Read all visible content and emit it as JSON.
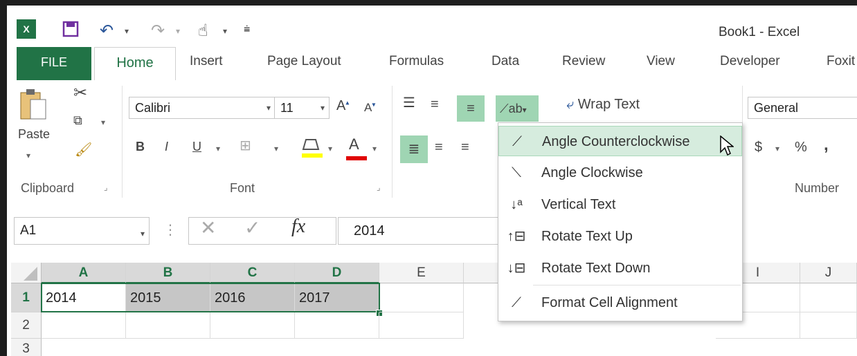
{
  "window": {
    "title": "Book1 - Excel"
  },
  "quick_access": {
    "app_icon": "excel-icon",
    "save_icon": "save-icon",
    "undo_icon": "undo-icon",
    "redo_icon": "redo-icon",
    "touch_icon": "touch-mode-icon",
    "customize_icon": "customize-icon"
  },
  "tabs": {
    "file": "FILE",
    "home": "Home",
    "insert": "Insert",
    "page_layout": "Page Layout",
    "formulas": "Formulas",
    "data": "Data",
    "review": "Review",
    "view": "View",
    "developer": "Developer",
    "foxit": "Foxit"
  },
  "ribbon": {
    "clipboard": {
      "paste": "Paste",
      "label": "Clipboard"
    },
    "font": {
      "name": "Calibri",
      "size": "11",
      "bold": "B",
      "italic": "I",
      "underline": "U",
      "font_color": "A",
      "label": "Font"
    },
    "alignment": {
      "wrap_text": "Wrap Text"
    },
    "number": {
      "format": "General",
      "currency": "$",
      "percent": "%",
      "comma": ",",
      "label": "Number"
    }
  },
  "formula_bar": {
    "name_box": "A1",
    "fx": "fx",
    "value": "2014"
  },
  "grid": {
    "columns": [
      "A",
      "B",
      "C",
      "D",
      "E",
      "I",
      "J"
    ],
    "rows": [
      "1",
      "2",
      "3"
    ],
    "row1": [
      "2014",
      "2015",
      "2016",
      "2017"
    ]
  },
  "orientation_menu": {
    "items": [
      {
        "label": "Angle Counterclockwise",
        "icon": "angle-counterclockwise-icon"
      },
      {
        "label": "Angle Clockwise",
        "icon": "angle-clockwise-icon"
      },
      {
        "label": "Vertical Text",
        "icon": "vertical-text-icon"
      },
      {
        "label": "Rotate Text Up",
        "icon": "rotate-text-up-icon"
      },
      {
        "label": "Rotate Text Down",
        "icon": "rotate-text-down-icon"
      },
      {
        "label": "Format Cell Alignment",
        "icon": "format-cell-alignment-icon"
      }
    ]
  },
  "colors": {
    "excel_green": "#217346",
    "highlight": "#9fd5b3",
    "menu_hover": "#d6ecde",
    "selected_fill": "#c6c6c6"
  }
}
